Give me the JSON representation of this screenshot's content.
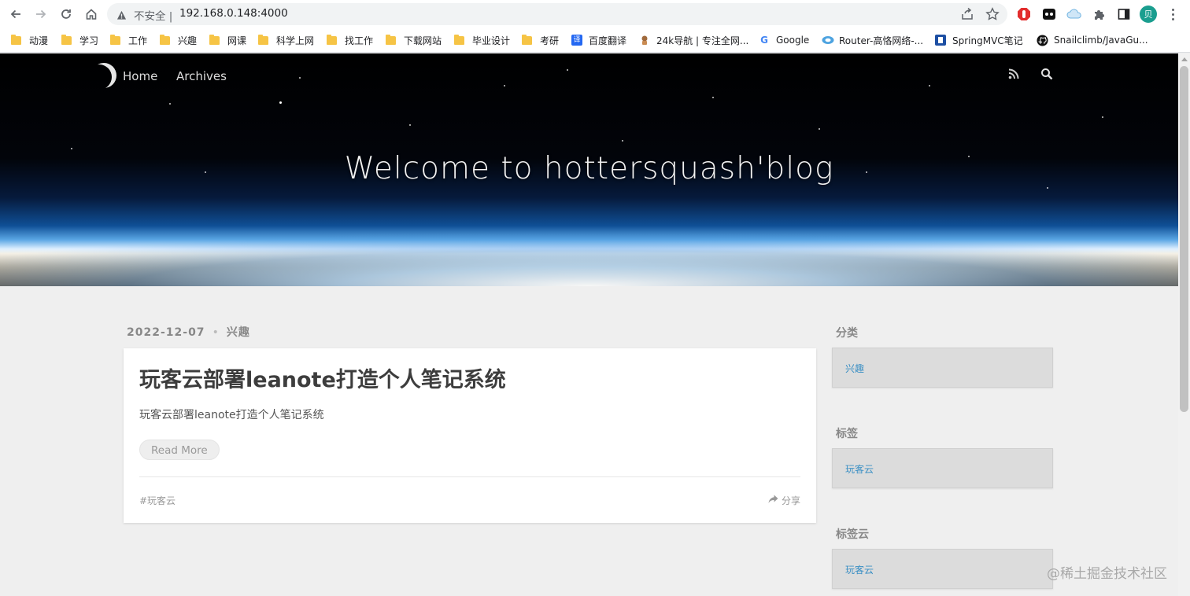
{
  "browser": {
    "security_label": "不安全",
    "separator": "|",
    "url": "192.168.0.148:4000",
    "avatar_letter": "贝",
    "bookmarks": [
      {
        "label": "动漫",
        "icon": "folder-icon"
      },
      {
        "label": "学习",
        "icon": "folder-icon"
      },
      {
        "label": "工作",
        "icon": "folder-icon"
      },
      {
        "label": "兴趣",
        "icon": "folder-icon"
      },
      {
        "label": "网课",
        "icon": "folder-icon"
      },
      {
        "label": "科学上网",
        "icon": "folder-icon"
      },
      {
        "label": "找工作",
        "icon": "folder-icon"
      },
      {
        "label": "下载网站",
        "icon": "folder-icon"
      },
      {
        "label": "毕业设计",
        "icon": "folder-icon"
      },
      {
        "label": "考研",
        "icon": "folder-icon"
      },
      {
        "label": "百度翻译",
        "icon": "translate-icon",
        "icon_text": "译"
      },
      {
        "label": "24k导航 | 专注全网...",
        "icon": "nav-site-icon"
      },
      {
        "label": "Google",
        "icon": "google-icon",
        "icon_text": "G"
      },
      {
        "label": "Router-高恪网络-...",
        "icon": "router-icon"
      },
      {
        "label": "SpringMVC笔记",
        "icon": "notes-icon"
      },
      {
        "label": "Snailclimb/JavaGu...",
        "icon": "github-icon"
      }
    ]
  },
  "site": {
    "nav": {
      "home": "Home",
      "archives": "Archives"
    },
    "hero_title": "Welcome to hottersquash'blog"
  },
  "post": {
    "date": "2022-12-07",
    "meta_dot": "•",
    "category": "兴趣",
    "title": "玩客云部署leanote打造个人笔记系统",
    "excerpt": "玩客云部署leanote打造个人笔记系统",
    "read_more": "Read More",
    "tag": "#玩客云",
    "share": "分享"
  },
  "sidebar": {
    "categories": {
      "title": "分类",
      "items": [
        "兴趣"
      ]
    },
    "tags": {
      "title": "标签",
      "items": [
        "玩客云"
      ]
    },
    "tag_cloud": {
      "title": "标签云",
      "items": [
        "玩客云"
      ]
    }
  },
  "watermark": "@稀土掘金技术社区",
  "colors": {
    "accent_link": "#3a8fc4",
    "avatar": "#1a9e8f",
    "folder": "#f6c445"
  }
}
